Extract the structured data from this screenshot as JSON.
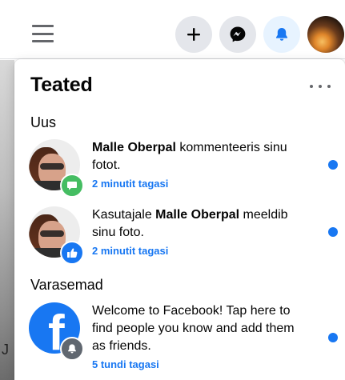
{
  "topbar": {
    "icons": [
      "menu-icon",
      "plus-icon",
      "messenger-icon",
      "bell-icon",
      "profile-avatar"
    ]
  },
  "panel": {
    "title": "Teated",
    "more_icon": "more-horizontal-icon"
  },
  "sections": {
    "new_label": "Uus",
    "earlier_label": "Varasemad"
  },
  "notifications": [
    {
      "prefix": "",
      "name": "Malle Oberpal",
      "suffix": " kommenteeris sinu fotot.",
      "time": "2 minutit tagasi",
      "badge_icon": "comment-icon",
      "unread": true
    },
    {
      "prefix": "Kasutajale ",
      "name": "Malle Oberpal",
      "suffix": " meeldib sinu foto.",
      "time": "2 minutit tagasi",
      "badge_icon": "like-icon",
      "unread": true
    },
    {
      "prefix": "Welcome to Facebook! Tap here to find people you know and add them as friends.",
      "name": "",
      "suffix": "",
      "time": "5 tundi tagasi",
      "badge_icon": "bell-icon",
      "unread": true
    }
  ],
  "background": {
    "partial_letter": "J"
  },
  "colors": {
    "accent": "#1877f2",
    "comment_badge": "#45bd62",
    "neutral_badge": "#606770"
  }
}
